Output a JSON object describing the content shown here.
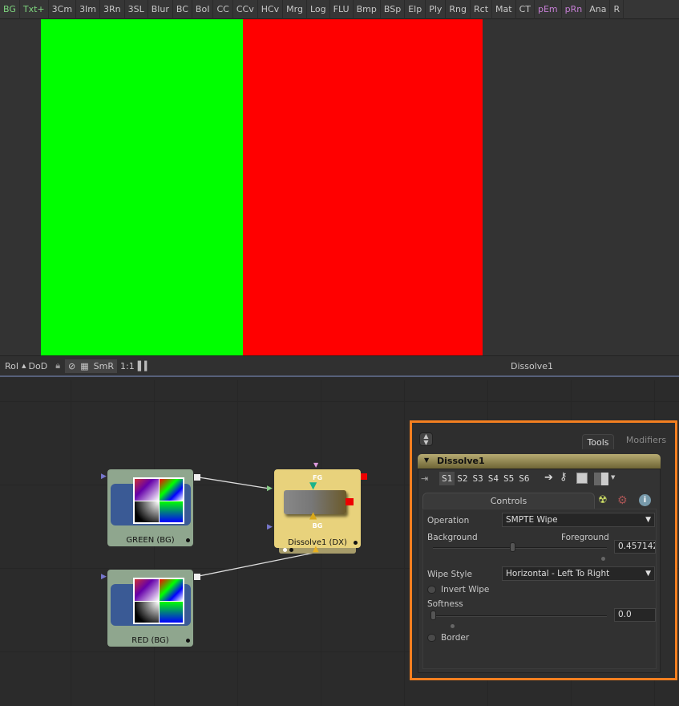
{
  "toolbar": {
    "items": [
      {
        "label": "BG",
        "color": "#7fd67f"
      },
      {
        "label": "Txt+",
        "color": "#7fd67f"
      },
      {
        "label": "3Cm"
      },
      {
        "label": "3Im"
      },
      {
        "label": "3Rn"
      },
      {
        "label": "3SL"
      },
      {
        "label": "Blur"
      },
      {
        "label": "BC"
      },
      {
        "label": "BoI"
      },
      {
        "label": "CC"
      },
      {
        "label": "CCv"
      },
      {
        "label": "HCv"
      },
      {
        "label": "Mrg"
      },
      {
        "label": "Log"
      },
      {
        "label": "FLU"
      },
      {
        "label": "Bmp"
      },
      {
        "label": "BSp"
      },
      {
        "label": "Elp"
      },
      {
        "label": "Ply"
      },
      {
        "label": "Rng"
      },
      {
        "label": "Rct"
      },
      {
        "label": "Mat"
      },
      {
        "label": "CT"
      },
      {
        "label": "pEm",
        "color": "#c77fd6"
      },
      {
        "label": "pRn",
        "color": "#c77fd6"
      },
      {
        "label": "Ana"
      },
      {
        "label": "R"
      }
    ]
  },
  "viewer": {
    "left_color": "#00ff00",
    "right_color": "#ff0000",
    "wipe_position": 0.457142
  },
  "viewbar": {
    "roi": "RoI",
    "dod": "DoD",
    "smr": "SmR",
    "scale": "1:1",
    "title": "Dissolve1"
  },
  "nodes": {
    "green": {
      "label": "GREEN  (BG)"
    },
    "red": {
      "label": "RED  (BG)"
    },
    "dissolve": {
      "label": "Dissolve1  (DX)",
      "fg": "FG",
      "bg": "BG"
    }
  },
  "panel": {
    "tabs": {
      "tools": "Tools",
      "modifiers": "Modifiers"
    },
    "tool_name": "Dissolve1",
    "slots": [
      "S1",
      "S2",
      "S3",
      "S4",
      "S5",
      "S6"
    ],
    "controls_tab": "Controls",
    "operation": {
      "label": "Operation",
      "value": "SMPTE Wipe"
    },
    "mix": {
      "left_label": "Background",
      "right_label": "Foreground",
      "value": "0.457142",
      "fraction": 0.457142
    },
    "wipe_style": {
      "label": "Wipe Style",
      "value": "Horizontal - Left To Right"
    },
    "invert_wipe": {
      "label": "Invert Wipe",
      "checked": false
    },
    "softness": {
      "label": "Softness",
      "value": "0.0",
      "fraction": 0
    },
    "border": {
      "label": "Border",
      "checked": false
    },
    "highlight_color": "#f47f20"
  }
}
